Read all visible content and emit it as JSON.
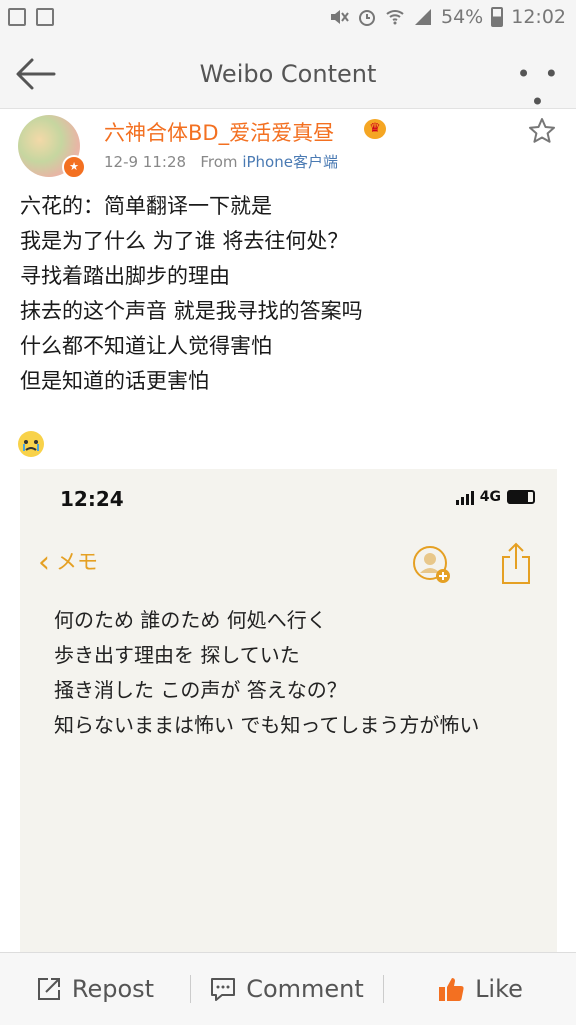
{
  "status_bar": {
    "battery": "54%",
    "time": "12:02"
  },
  "nav": {
    "title": "Weibo Content",
    "more": "• • •"
  },
  "post": {
    "user_name": "六神合体BD_爱活爱真昼",
    "date": "12-9 11:28",
    "source_prefix": "From",
    "source": "iPhone客户端",
    "lines": [
      "六花的：简单翻译一下就是",
      "我是为了什么 为了谁 将去往何处？",
      "寻找着踏出脚步的理由",
      "抹去的这个声音 就是我寻找的答案吗",
      "什么都不知道让人觉得害怕",
      "但是知道的话更害怕"
    ]
  },
  "embedded_screenshot": {
    "time": "12:24",
    "network": "4G",
    "back_label": "メモ",
    "memo_lines": [
      "何のため 誰のため 何処へ行く",
      "歩き出す理由を 探していた",
      "掻き消した この声が 答えなの？",
      "知らないままは怖い でも知ってしまう方が怖い"
    ]
  },
  "tab_bar": {
    "repost": "Repost",
    "comment": "Comment",
    "like": "Like"
  },
  "colors": {
    "accent": "#f37021",
    "link": "#4a7ab3",
    "memo_accent": "#e5a023"
  }
}
